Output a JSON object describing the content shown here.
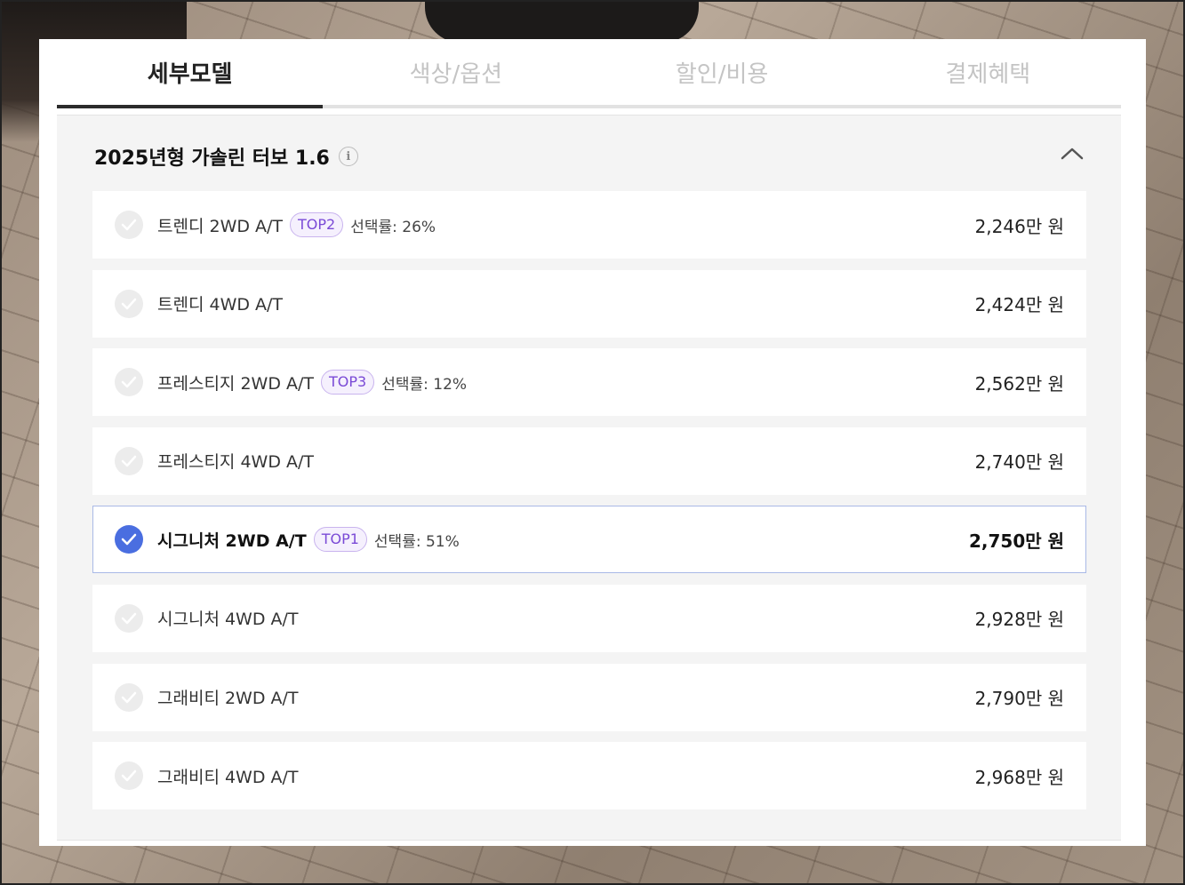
{
  "tabs": [
    {
      "label": "세부모델",
      "active": true
    },
    {
      "label": "색상/옵션",
      "active": false
    },
    {
      "label": "할인/비용",
      "active": false
    },
    {
      "label": "결제혜택",
      "active": false
    }
  ],
  "section": {
    "title": "2025년형 가솔린 터보 1.6",
    "info_icon": "info-icon",
    "collapse_icon": "chevron-up-icon"
  },
  "models": [
    {
      "name": "트렌디 2WD A/T",
      "badge": "TOP2",
      "rate": "선택률: 26%",
      "price": "2,246만 원",
      "selected": false
    },
    {
      "name": "트렌디 4WD A/T",
      "badge": "",
      "rate": "",
      "price": "2,424만 원",
      "selected": false
    },
    {
      "name": "프레스티지 2WD A/T",
      "badge": "TOP3",
      "rate": "선택률: 12%",
      "price": "2,562만 원",
      "selected": false
    },
    {
      "name": "프레스티지 4WD A/T",
      "badge": "",
      "rate": "",
      "price": "2,740만 원",
      "selected": false
    },
    {
      "name": "시그니처 2WD A/T",
      "badge": "TOP1",
      "rate": "선택률: 51%",
      "price": "2,750만 원",
      "selected": true
    },
    {
      "name": "시그니처 4WD A/T",
      "badge": "",
      "rate": "",
      "price": "2,928만 원",
      "selected": false
    },
    {
      "name": "그래비티 2WD A/T",
      "badge": "",
      "rate": "",
      "price": "2,790만 원",
      "selected": false
    },
    {
      "name": "그래비티 4WD A/T",
      "badge": "",
      "rate": "",
      "price": "2,968만 원",
      "selected": false
    }
  ],
  "colors": {
    "selected_check": "#4a6ee0",
    "badge_text": "#7a4ad6",
    "selected_border": "#a9b9e6"
  }
}
